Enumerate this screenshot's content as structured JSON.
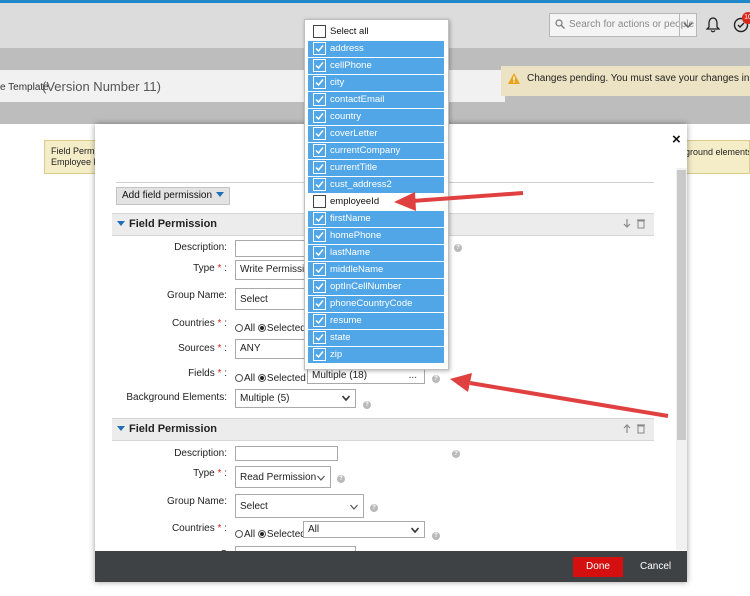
{
  "header": {
    "search_placeholder": "Search for actions or people",
    "notification_count": "10"
  },
  "page": {
    "title_prefix": "e Template",
    "version": "(Version Number 11)",
    "pending_message": "Changes pending. You must save your changes in order to"
  },
  "banner": {
    "left_line1": "Field Permi",
    "left_line2": "Employee F",
    "right_text": "ground elements"
  },
  "modal": {
    "add_button_label": "Add field permission",
    "section1": {
      "title": "Field Permission",
      "description_label": "Description:",
      "description_value": "",
      "type_label": "Type",
      "type_value": "Write Permission",
      "group_label": "Group Name:",
      "group_value": "Select",
      "countries_label": "Countries",
      "countries_all": "All",
      "countries_selected": "Selected",
      "sources_label": "Sources",
      "sources_value": "ANY",
      "fields_label": "Fields",
      "fields_all": "All",
      "fields_selected": "Selected",
      "fields_value": "Multiple (18)",
      "fields_more": "...",
      "background_label": "Background Elements:",
      "background_value": "Multiple (5)"
    },
    "section2": {
      "title": "Field Permission",
      "description_label": "Description:",
      "description_value": "",
      "type_label": "Type",
      "type_value": "Read Permission",
      "group_label": "Group Name:",
      "group_value": "Select",
      "countries_label": "Countries",
      "countries_all": "All",
      "countries_selected": "Selected",
      "countries_value": "All",
      "sources_label": "S"
    },
    "required_mark": "*",
    "colon": ":",
    "close_glyph": "×",
    "done_label": "Done",
    "cancel_label": "Cancel"
  },
  "fields_popup": {
    "select_all_label": "Select all",
    "select_all_checked": false,
    "options": [
      {
        "label": "address",
        "checked": true
      },
      {
        "label": "cellPhone",
        "checked": true
      },
      {
        "label": "city",
        "checked": true
      },
      {
        "label": "contactEmail",
        "checked": true
      },
      {
        "label": "country",
        "checked": true
      },
      {
        "label": "coverLetter",
        "checked": true
      },
      {
        "label": "currentCompany",
        "checked": true
      },
      {
        "label": "currentTitle",
        "checked": true
      },
      {
        "label": "cust_address2",
        "checked": true
      },
      {
        "label": "employeeId",
        "checked": false
      },
      {
        "label": "firstName",
        "checked": true
      },
      {
        "label": "homePhone",
        "checked": true
      },
      {
        "label": "lastName",
        "checked": true
      },
      {
        "label": "middleName",
        "checked": true
      },
      {
        "label": "optInCellNumber",
        "checked": true
      },
      {
        "label": "phoneCountryCode",
        "checked": true
      },
      {
        "label": "resume",
        "checked": true
      },
      {
        "label": "state",
        "checked": true
      },
      {
        "label": "zip",
        "checked": true
      }
    ]
  },
  "colors": {
    "accent_blue": "#51a6e7",
    "done_red": "#d50f0f",
    "arrow_red": "#e04040",
    "footer_dark": "#3f4245"
  }
}
